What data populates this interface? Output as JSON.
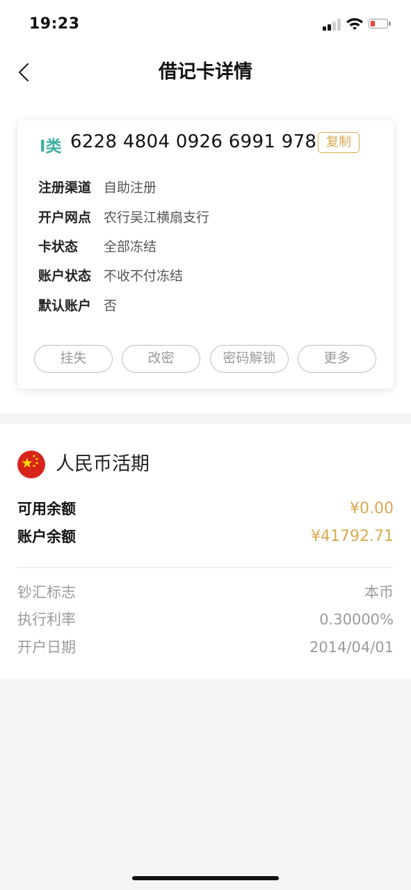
{
  "status_bar": {
    "time": "19:23"
  },
  "nav": {
    "title": "借记卡详情",
    "back_icon": "chevron-left-icon"
  },
  "card": {
    "type_label": "I类",
    "number": "6228 4804 0926 6991 978",
    "copy_label": "复制",
    "info": [
      {
        "label": "注册渠道",
        "value": "自助注册"
      },
      {
        "label": "开户网点",
        "value": "农行吴江横扇支行"
      },
      {
        "label": "卡状态",
        "value": "全部冻结"
      },
      {
        "label": "账户状态",
        "value": "不收不付冻结"
      },
      {
        "label": "默认账户",
        "value": "否"
      }
    ],
    "actions": [
      "挂失",
      "改密",
      "密码解锁",
      "更多"
    ]
  },
  "account": {
    "title": "人民币活期",
    "flag_icon": "china-flag-icon",
    "balances": [
      {
        "label": "可用余额",
        "value": "¥0.00"
      },
      {
        "label": "账户余额",
        "value": "¥41792.71"
      }
    ],
    "details": [
      {
        "label": "钞汇标志",
        "value": "本币"
      },
      {
        "label": "执行利率",
        "value": "0.30000%"
      },
      {
        "label": "开户日期",
        "value": "2014/04/01"
      }
    ]
  },
  "colors": {
    "accent_gold": "#d9a94f",
    "type_teal": "#3db0a2",
    "flag_red": "#d8251c"
  }
}
